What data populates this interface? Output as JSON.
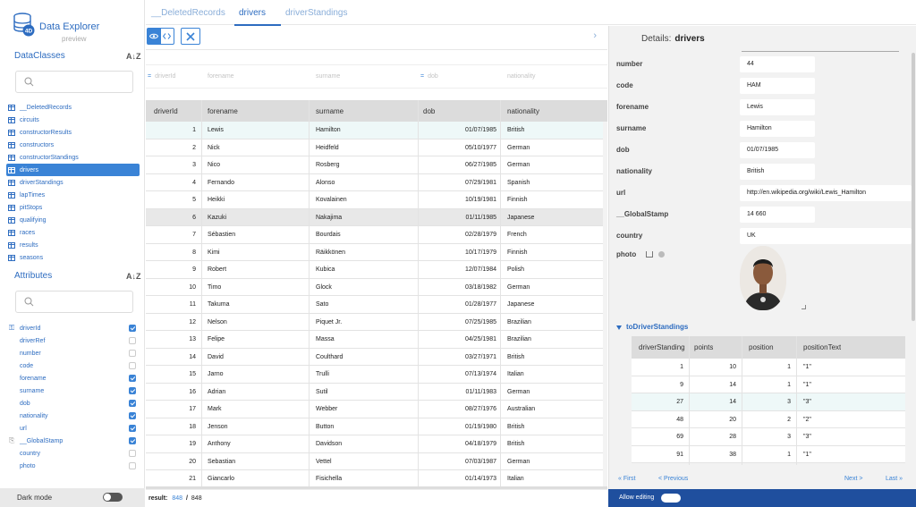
{
  "app": {
    "title": "Data Explorer",
    "subtitle": "preview"
  },
  "sidebar": {
    "dataclasses_title": "DataClasses",
    "attributes_title": "Attributes",
    "sort_label": "A↓Z",
    "classes": [
      {
        "label": "__DeletedRecords",
        "active": false
      },
      {
        "label": "circuits",
        "active": false
      },
      {
        "label": "constructorResults",
        "active": false
      },
      {
        "label": "constructors",
        "active": false
      },
      {
        "label": "constructorStandings",
        "active": false
      },
      {
        "label": "drivers",
        "active": true
      },
      {
        "label": "driverStandings",
        "active": false
      },
      {
        "label": "lapTimes",
        "active": false
      },
      {
        "label": "pitStops",
        "active": false
      },
      {
        "label": "qualifying",
        "active": false
      },
      {
        "label": "races",
        "active": false
      },
      {
        "label": "results",
        "active": false
      },
      {
        "label": "seasons",
        "active": false
      }
    ],
    "attributes": [
      {
        "label": "driverId",
        "checked": true,
        "icon": "key"
      },
      {
        "label": "driverRef",
        "checked": false,
        "icon": ""
      },
      {
        "label": "number",
        "checked": false,
        "icon": ""
      },
      {
        "label": "code",
        "checked": false,
        "icon": ""
      },
      {
        "label": "forename",
        "checked": true,
        "icon": ""
      },
      {
        "label": "surname",
        "checked": true,
        "icon": ""
      },
      {
        "label": "dob",
        "checked": true,
        "icon": ""
      },
      {
        "label": "nationality",
        "checked": true,
        "icon": ""
      },
      {
        "label": "url",
        "checked": true,
        "icon": ""
      },
      {
        "label": "__GlobalStamp",
        "checked": true,
        "icon": "stamp"
      },
      {
        "label": "country",
        "checked": false,
        "icon": ""
      },
      {
        "label": "photo",
        "checked": false,
        "icon": ""
      }
    ],
    "dark_mode_label": "Dark mode"
  },
  "tabs": [
    {
      "label": "__DeletedRecords",
      "active": false
    },
    {
      "label": "drivers",
      "active": true
    },
    {
      "label": "driverStandings",
      "active": false
    }
  ],
  "grid": {
    "columns": [
      "driverId",
      "forename",
      "surname",
      "dob",
      "nationality"
    ],
    "filters": [
      "driverId",
      "forename",
      "surname",
      "dob",
      "nationality"
    ],
    "rows": [
      [
        "1",
        "Lewis",
        "Hamilton",
        "01/07/1985",
        "British"
      ],
      [
        "2",
        "Nick",
        "Heidfeld",
        "05/10/1977",
        "German"
      ],
      [
        "3",
        "Nico",
        "Rosberg",
        "06/27/1985",
        "German"
      ],
      [
        "4",
        "Fernando",
        "Alonso",
        "07/29/1981",
        "Spanish"
      ],
      [
        "5",
        "Heikki",
        "Kovalainen",
        "10/19/1981",
        "Finnish"
      ],
      [
        "6",
        "Kazuki",
        "Nakajima",
        "01/11/1985",
        "Japanese"
      ],
      [
        "7",
        "Sébastien",
        "Bourdais",
        "02/28/1979",
        "French"
      ],
      [
        "8",
        "Kimi",
        "Räikkönen",
        "10/17/1979",
        "Finnish"
      ],
      [
        "9",
        "Robert",
        "Kubica",
        "12/07/1984",
        "Polish"
      ],
      [
        "10",
        "Timo",
        "Glock",
        "03/18/1982",
        "German"
      ],
      [
        "11",
        "Takuma",
        "Sato",
        "01/28/1977",
        "Japanese"
      ],
      [
        "12",
        "Nelson",
        "Piquet Jr.",
        "07/25/1985",
        "Brazilian"
      ],
      [
        "13",
        "Felipe",
        "Massa",
        "04/25/1981",
        "Brazilian"
      ],
      [
        "14",
        "David",
        "Coulthard",
        "03/27/1971",
        "British"
      ],
      [
        "15",
        "Jarno",
        "Trulli",
        "07/13/1974",
        "Italian"
      ],
      [
        "16",
        "Adrian",
        "Sutil",
        "01/11/1983",
        "German"
      ],
      [
        "17",
        "Mark",
        "Webber",
        "08/27/1976",
        "Australian"
      ],
      [
        "18",
        "Jenson",
        "Button",
        "01/19/1980",
        "British"
      ],
      [
        "19",
        "Anthony",
        "Davidson",
        "04/18/1979",
        "British"
      ],
      [
        "20",
        "Sebastian",
        "Vettel",
        "07/03/1987",
        "German"
      ],
      [
        "21",
        "Giancarlo",
        "Fisichella",
        "01/14/1973",
        "Italian"
      ]
    ],
    "selected_row": 0,
    "hover_row": 5,
    "result_label": "result:",
    "result_count": "848",
    "result_sep": "/",
    "result_total": "848"
  },
  "details": {
    "title_prefix": "Details:",
    "title_entity": "drivers",
    "fields": [
      {
        "label": "number",
        "value": "44"
      },
      {
        "label": "code",
        "value": "HAM"
      },
      {
        "label": "forename",
        "value": "Lewis"
      },
      {
        "label": "surname",
        "value": "Hamilton"
      },
      {
        "label": "dob",
        "value": "01/07/1985"
      },
      {
        "label": "nationality",
        "value": "British"
      },
      {
        "label": "url",
        "value": "http://en.wikipedia.org/wiki/Lewis_Hamilton"
      },
      {
        "label": "__GlobalStamp",
        "value": "14 660"
      },
      {
        "label": "country",
        "value": "UK"
      }
    ],
    "photo_label": "photo",
    "relation_title": "toDriverStandings",
    "relation_columns": [
      "driverStanding",
      "points",
      "position",
      "positionText"
    ],
    "relation_rows": [
      [
        "1",
        "10",
        "1",
        "\"1\""
      ],
      [
        "9",
        "14",
        "1",
        "\"1\""
      ],
      [
        "27",
        "14",
        "3",
        "\"3\""
      ],
      [
        "48",
        "20",
        "2",
        "\"2\""
      ],
      [
        "69",
        "28",
        "3",
        "\"3\""
      ],
      [
        "91",
        "38",
        "1",
        "\"1\""
      ]
    ],
    "relation_selected": 2,
    "pager": {
      "first": "« First",
      "prev": "< Previous",
      "next": "Next >",
      "last": "Last »"
    },
    "allow_editing_label": "Allow editing"
  },
  "colors": {
    "accent": "#3a83d6",
    "brand": "#2d6cc0",
    "footer": "#1f4f9e"
  }
}
